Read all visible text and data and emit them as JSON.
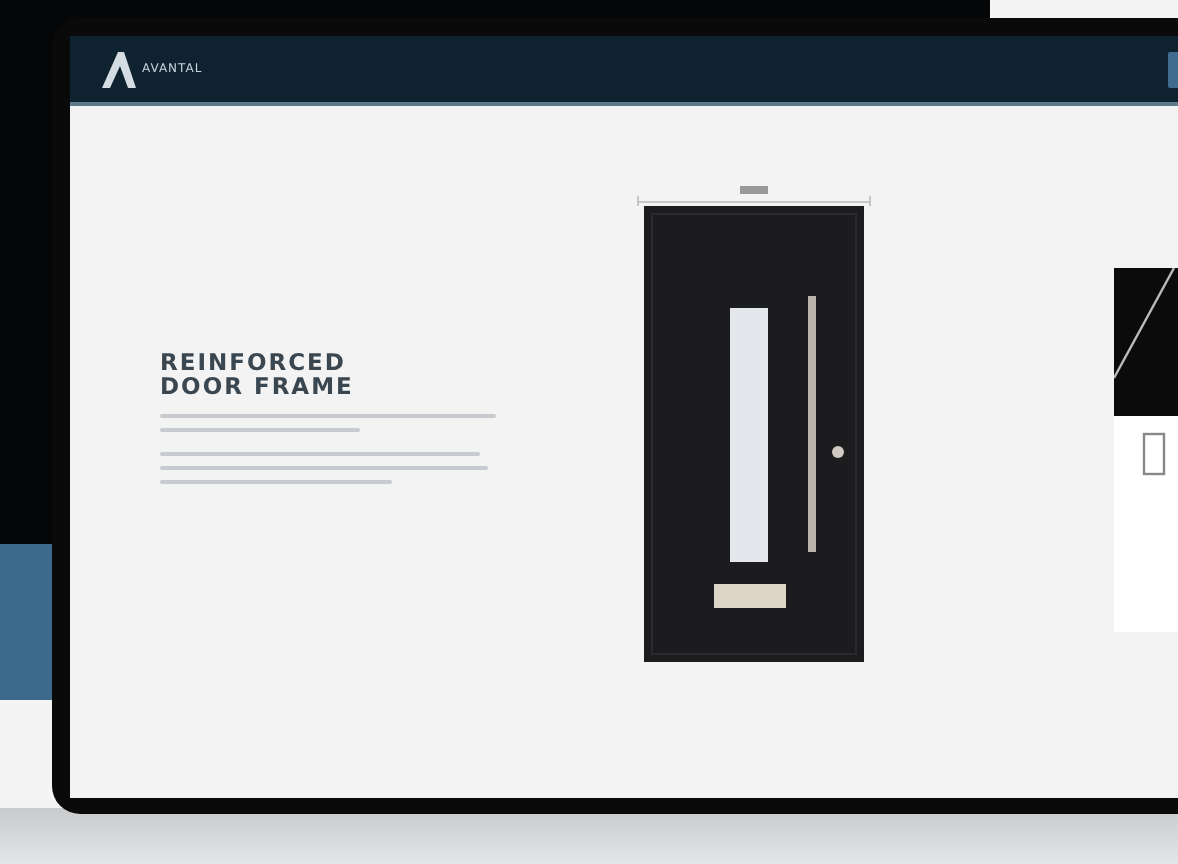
{
  "header": {
    "logo_text": "AVANTAL"
  },
  "hero": {
    "heading": "REINFORCED DOOR FRAME"
  }
}
